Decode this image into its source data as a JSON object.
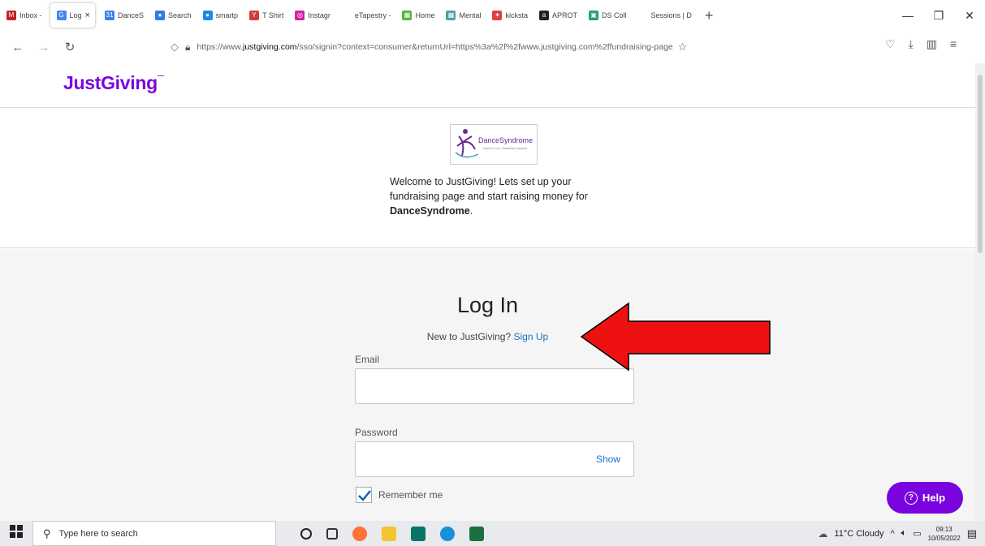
{
  "browser": {
    "tabs": [
      {
        "label": "Inbox -",
        "color": "#c5221f",
        "glyph": "M"
      },
      {
        "label": "Log",
        "color": "#4285f4",
        "glyph": "G",
        "active": true
      },
      {
        "label": "DanceS",
        "color": "#3b82f6",
        "glyph": "31"
      },
      {
        "label": "Search",
        "color": "#2f7de1",
        "glyph": "●"
      },
      {
        "label": "smartp",
        "color": "#1e88e5",
        "glyph": "●"
      },
      {
        "label": "T Shirt",
        "color": "#d23c3c",
        "glyph": "Y"
      },
      {
        "label": "Instagr",
        "color": "#d6249f",
        "glyph": "◎"
      },
      {
        "label": "eTapestry -",
        "color": "#ffffff",
        "glyph": ""
      },
      {
        "label": "Home",
        "color": "#5ab33c",
        "glyph": "▦"
      },
      {
        "label": "Mental",
        "color": "#4aa3a0",
        "glyph": "▦"
      },
      {
        "label": "kicksta",
        "color": "#e0403c",
        "glyph": "✦"
      },
      {
        "label": "APROT",
        "color": "#222222",
        "glyph": "a"
      },
      {
        "label": "DS Coll",
        "color": "#1da462",
        "glyph": "▣"
      },
      {
        "label": "Sessions | D",
        "color": "#ffffff",
        "glyph": ""
      }
    ],
    "close_glyph": "×",
    "new_tab": "+",
    "url_prefix": "https://www.",
    "url_domain": "justgiving.com",
    "url_rest": "/sso/signin?context=consumer&returnUrl=https%3a%2f%2fwww.justgiving.com%2ffundraising-page"
  },
  "page": {
    "logo_text": "JustGiving",
    "charity_logo_text": "DanceSyndrome",
    "charity_logo_sub": "Dancer Led, Disability Inspired",
    "welcome_text": "Welcome to JustGiving! Lets set up your fundraising page and start raising money for",
    "charity_name": "DanceSyndrome",
    "period": ".",
    "login_title": "Log In",
    "signup_prompt": "New to JustGiving?",
    "signup_link": "Sign Up",
    "email_label": "Email",
    "password_label": "Password",
    "show_label": "Show",
    "remember_label": "Remember me",
    "help_label": "Help"
  },
  "taskbar": {
    "search_placeholder": "Type here to search",
    "weather": "11°C  Cloudy",
    "time": "09:13",
    "date": "10/05/2022"
  }
}
